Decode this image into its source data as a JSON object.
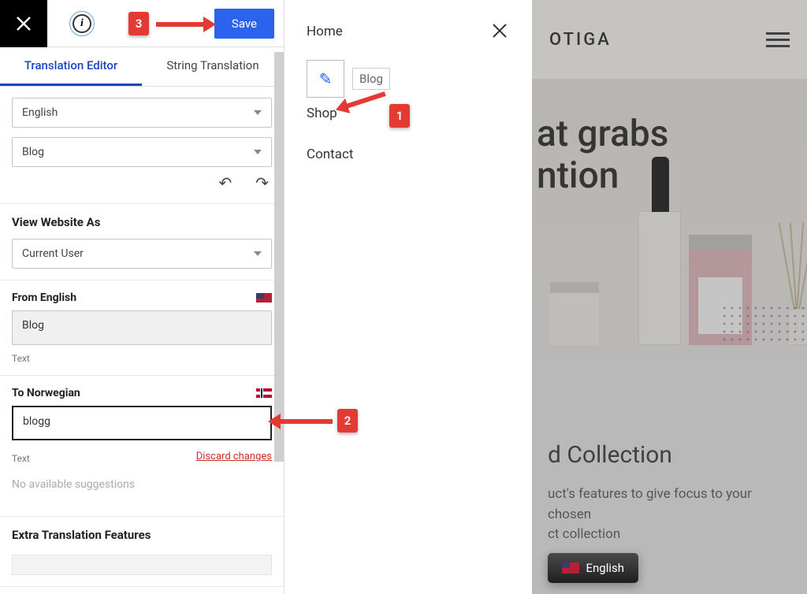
{
  "annotations": {
    "step1": "1",
    "step2": "2",
    "step3": "3"
  },
  "topbar": {
    "info_glyph": "i",
    "save_label": "Save"
  },
  "tabs": {
    "editor": "Translation Editor",
    "string": "String Translation"
  },
  "selects": {
    "language": "English",
    "string_item": "Blog"
  },
  "view_as": {
    "heading": "View Website As",
    "value": "Current User"
  },
  "from": {
    "label": "From English",
    "value": "Blog",
    "type": "Text"
  },
  "to": {
    "label": "To Norwegian",
    "value": "blogg",
    "type": "Text",
    "discard": "Discard changes"
  },
  "suggestions": {
    "none": "No available suggestions"
  },
  "extra": {
    "heading": "Extra Translation Features"
  },
  "menu": {
    "home": "Home",
    "blog": "Blog",
    "shop": "Shop",
    "contact": "Contact"
  },
  "site": {
    "brand": "OTIGA",
    "hero_line1": "at grabs",
    "hero_line2": "ntion",
    "section_title": "d Collection",
    "section_desc1": "uct's features to give focus to your chosen",
    "section_desc2": "ct collection",
    "lang_label": "English"
  }
}
